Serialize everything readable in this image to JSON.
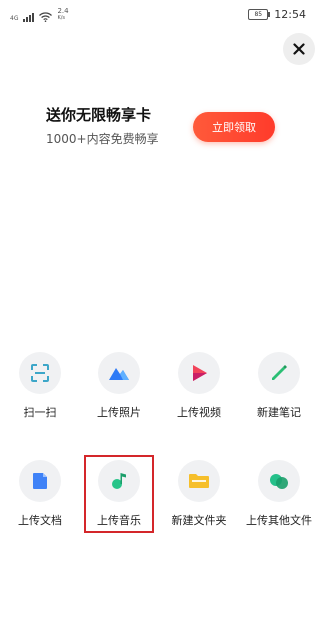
{
  "status_bar": {
    "network_type": "4G",
    "speed_value": "2.4",
    "speed_unit": "K/s",
    "battery_level": "85",
    "time": "12:54"
  },
  "close_icon": "close-icon",
  "promo": {
    "title": "送你无限畅享卡",
    "subtitle": "1000+内容免费畅享",
    "button_label": "立即领取",
    "accent": "#ff4a32"
  },
  "actions": [
    {
      "label": "扫一扫",
      "icon": "scan-icon",
      "color": "#3ca6c8"
    },
    {
      "label": "上传照片",
      "icon": "photo-icon",
      "color": "#2f7bf6"
    },
    {
      "label": "上传视频",
      "icon": "video-icon",
      "color": "#f2445a"
    },
    {
      "label": "新建笔记",
      "icon": "pen-icon",
      "color": "#2bbf74"
    },
    {
      "label": "上传文档",
      "icon": "document-icon",
      "color": "#3f82f7"
    },
    {
      "label": "上传音乐",
      "icon": "music-note-icon",
      "color": "#27c489"
    },
    {
      "label": "新建文件夹",
      "icon": "folder-icon",
      "color": "#f6bf2b"
    },
    {
      "label": "上传其他文件",
      "icon": "other-files-icon",
      "color": "#25c08a"
    }
  ],
  "highlighted_action": "上传音乐"
}
